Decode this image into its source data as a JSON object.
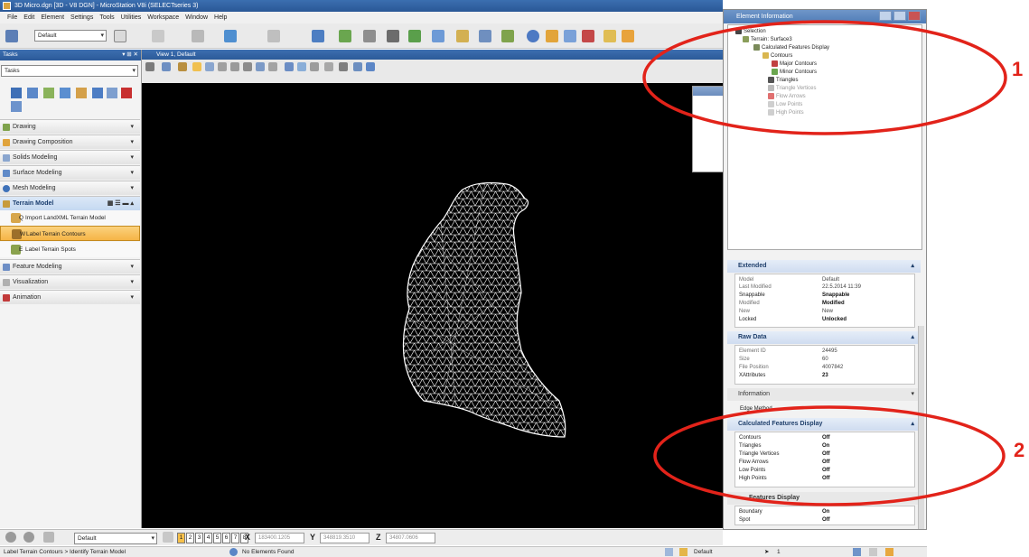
{
  "window": {
    "title": "3D Micro.dgn [3D - V8 DGN] - MicroStation V8i (SELECTseries 3)"
  },
  "menu": [
    "File",
    "Edit",
    "Element",
    "Settings",
    "Tools",
    "Utilities",
    "Workspace",
    "Window",
    "Help"
  ],
  "toolbar": {
    "level_combo": "Default"
  },
  "tasks": {
    "header": "Tasks",
    "combo": "Tasks",
    "categories": [
      {
        "label": "Drawing"
      },
      {
        "label": "Drawing Composition"
      },
      {
        "label": "Solids Modeling"
      },
      {
        "label": "Surface Modeling"
      },
      {
        "label": "Mesh Modeling"
      },
      {
        "label": "Terrain Model"
      },
      {
        "label": "Feature Modeling"
      },
      {
        "label": "Visualization"
      },
      {
        "label": "Animation"
      }
    ],
    "terrain_tools": [
      {
        "key": "Q",
        "label": "Import LandXML Terrain Model"
      },
      {
        "key": "W",
        "label": "Label Terrain Contours"
      },
      {
        "key": "E",
        "label": "Label Terrain Spots"
      }
    ]
  },
  "view": {
    "title": "View 1, Default"
  },
  "element_info": {
    "title": "Element Information",
    "tree": {
      "root": "Selection",
      "element": "Terrain: Surface3",
      "calc": "Calculated Features Display",
      "contours": "Contours",
      "major": "Major Contours",
      "minor": "Minor Contours",
      "triangles": "Triangles",
      "triangle_vertices": "Triangle Vertices",
      "flow_arrows": "Flow Arrows",
      "low_points": "Low Points",
      "high_points": "High Points"
    },
    "extended": {
      "header": "Extended",
      "rows": [
        {
          "k": "Model",
          "v": "Default"
        },
        {
          "k": "Last Modified",
          "v": "22.5.2014 11:39"
        },
        {
          "k": "Snappable",
          "v": "Snappable"
        },
        {
          "k": "Modified",
          "v": "Modified"
        },
        {
          "k": "New",
          "v": "New"
        },
        {
          "k": "Locked",
          "v": "Unlocked"
        }
      ]
    },
    "raw_data": {
      "header": "Raw Data",
      "rows": [
        {
          "k": "Element ID",
          "v": "24495"
        },
        {
          "k": "Size",
          "v": "60"
        },
        {
          "k": "File Position",
          "v": "4007842"
        },
        {
          "k": "XAttributes",
          "v": "23"
        }
      ]
    },
    "information_header": "Information",
    "edge_method": "Edge Method",
    "calc_display": {
      "header": "Calculated Features Display",
      "rows": [
        {
          "k": "Contours",
          "v": "Off"
        },
        {
          "k": "Triangles",
          "v": "On"
        },
        {
          "k": "Triangle Vertices",
          "v": "Off"
        },
        {
          "k": "Flow Arrows",
          "v": "Off"
        },
        {
          "k": "Low Points",
          "v": "Off"
        },
        {
          "k": "High Points",
          "v": "Off"
        }
      ]
    },
    "source_display": {
      "header": "Features Display",
      "rows": [
        {
          "k": "Boundary",
          "v": "On"
        },
        {
          "k": "Spot",
          "v": "Off"
        }
      ]
    }
  },
  "bottom": {
    "combo": "Default",
    "views": [
      "1",
      "2",
      "3",
      "4",
      "5",
      "6",
      "7",
      "8"
    ],
    "x_label": "X",
    "x_value": "183400.1205",
    "y_label": "Y",
    "y_value": "348819.3510",
    "z_label": "Z",
    "z_value": "34807.0606"
  },
  "status": {
    "prompt": "Label Terrain Contours > Identify Terrain Model",
    "message": "No Elements Found",
    "level": "Default",
    "count": "1"
  },
  "callouts": [
    "1",
    "2"
  ],
  "colors": {
    "callout_red": "#e2231a",
    "title_blue": "#2b5a99",
    "selected_orange": "#f5b446"
  }
}
